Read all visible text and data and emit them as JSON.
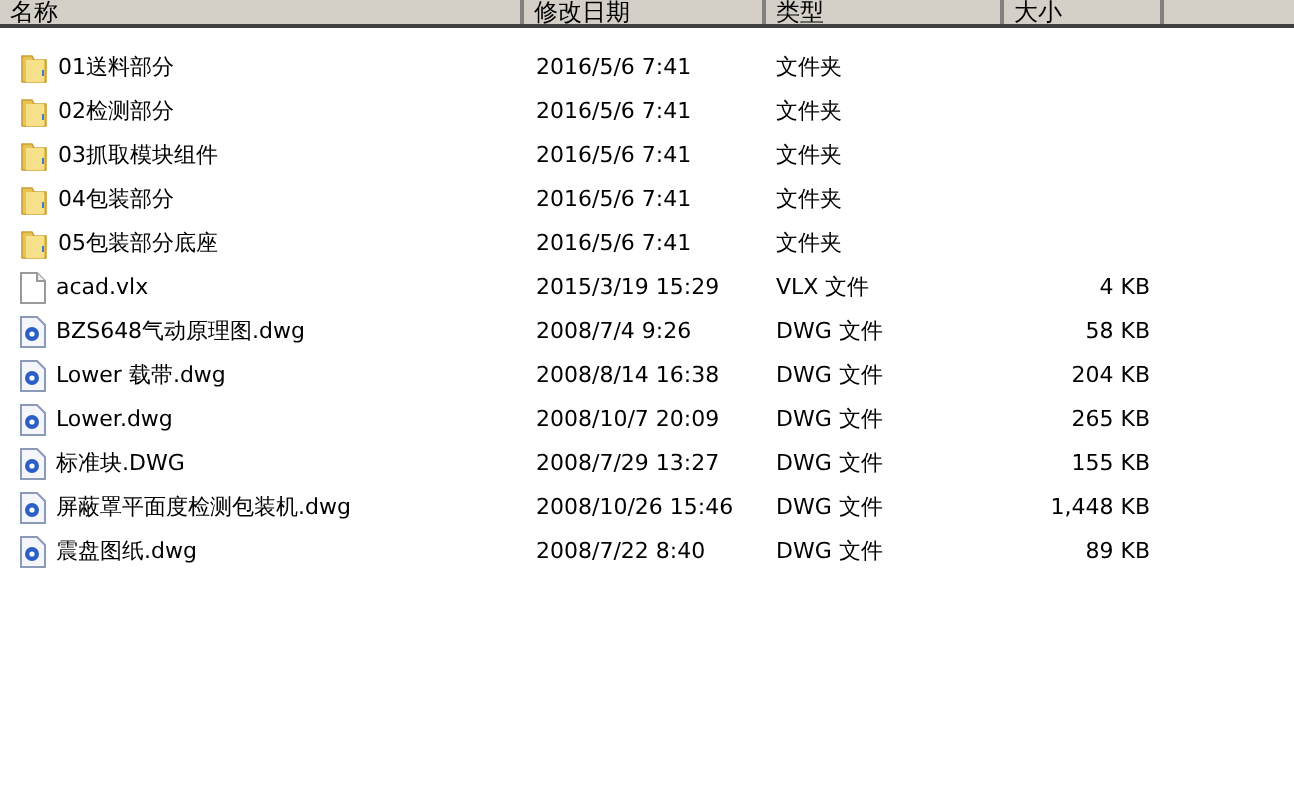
{
  "columns": [
    {
      "label": "名称",
      "kind": "name"
    },
    {
      "label": "修改日期",
      "kind": "date"
    },
    {
      "label": "类型",
      "kind": "type"
    },
    {
      "label": "大小",
      "kind": "size"
    }
  ],
  "rows": [
    {
      "kind": "folder",
      "name": "01送料部分",
      "date": "2016/5/6 7:41",
      "type": "文件夹"
    },
    {
      "kind": "folder",
      "name": "02检测部分",
      "date": "2016/5/6 7:41",
      "type": "文件夹"
    },
    {
      "kind": "folder",
      "name": "03抓取模块组件",
      "date": "2016/5/6 7:41",
      "type": "文件夹"
    },
    {
      "kind": "folder",
      "name": "04包装部分",
      "date": "2016/5/6 7:41",
      "type": "文件夹"
    },
    {
      "kind": "folder",
      "name": "05包装部分底座",
      "date": "2016/5/6 7:41",
      "type": "文件夹"
    },
    {
      "kind": "file",
      "name": "acad.vlx",
      "date": "2015/3/19 15:29",
      "type": "VLX 文件",
      "size": "4 KB"
    },
    {
      "kind": "dwg",
      "name": "BZS648气动原理图.dwg",
      "date": "2008/7/4 9:26",
      "type": "DWG 文件",
      "size": "58 KB"
    },
    {
      "kind": "dwg",
      "name": "Lower 载带.dwg",
      "date": "2008/8/14 16:38",
      "type": "DWG 文件",
      "size": "204 KB"
    },
    {
      "kind": "dwg",
      "name": "Lower.dwg",
      "date": "2008/10/7 20:09",
      "type": "DWG 文件",
      "size": "265 KB"
    },
    {
      "kind": "dwg",
      "name": "标准块.DWG",
      "date": "2008/7/29 13:27",
      "type": "DWG 文件",
      "size": "155 KB"
    },
    {
      "kind": "dwg",
      "name": "屏蔽罩平面度检测包装机.dwg",
      "date": "2008/10/26 15:46",
      "type": "DWG 文件",
      "size": "1,448 KB"
    },
    {
      "kind": "dwg",
      "name": "震盘图纸.dwg",
      "date": "2008/7/22 8:40",
      "type": "DWG 文件",
      "size": "89 KB"
    }
  ]
}
